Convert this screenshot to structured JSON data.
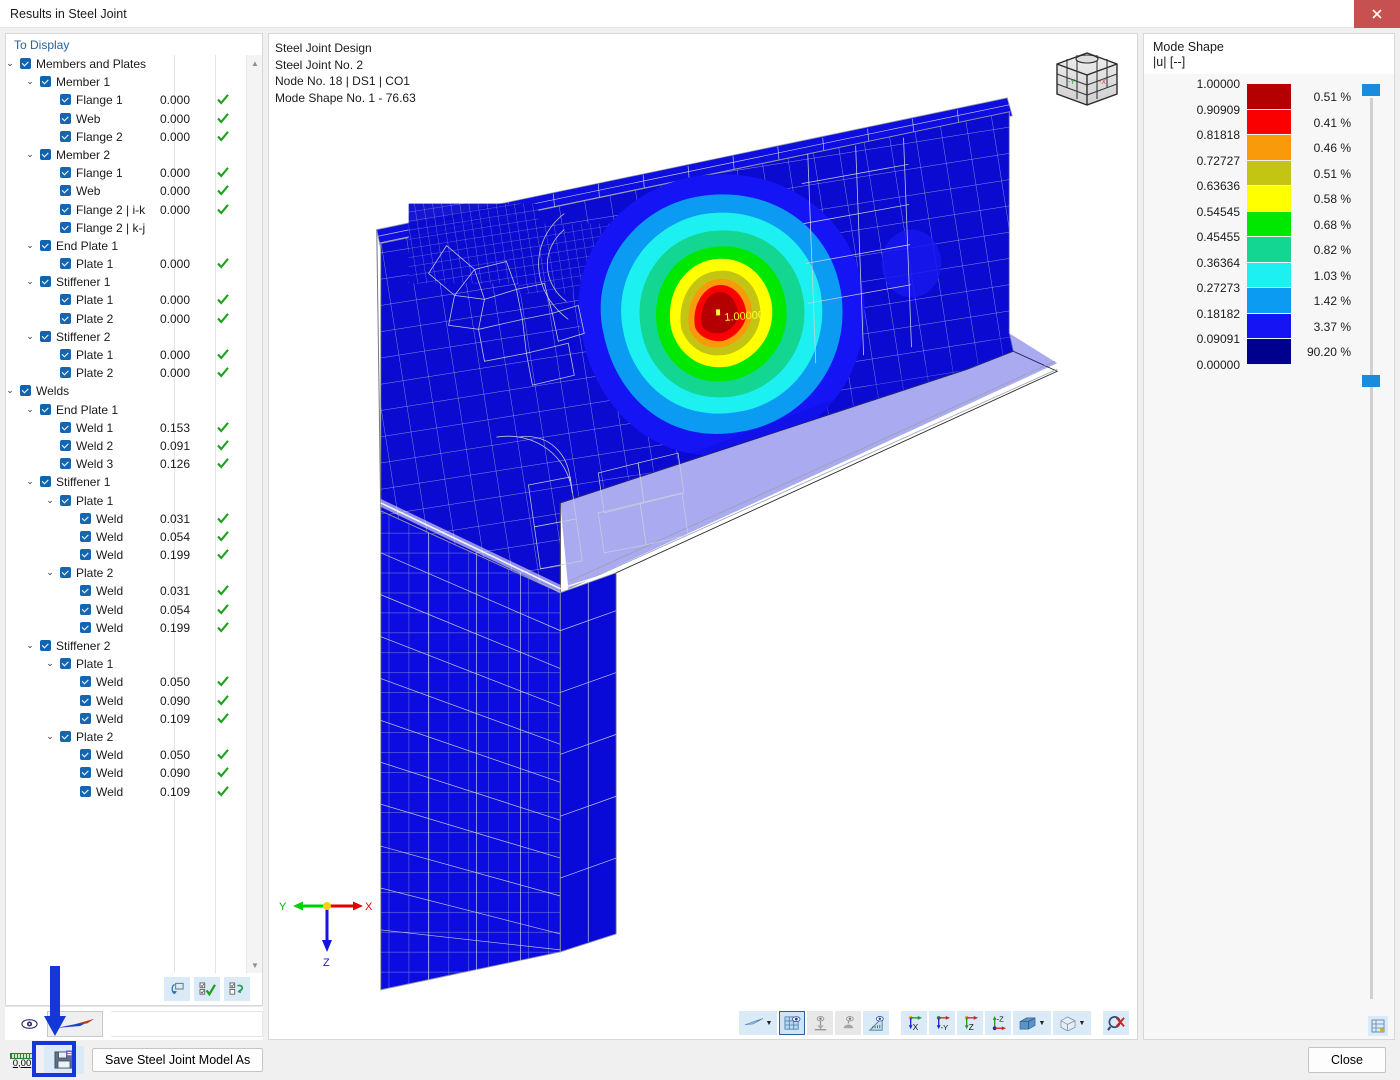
{
  "window": {
    "title": "Results in Steel Joint",
    "close_label": "x"
  },
  "left_panel": {
    "group_label": "To Display",
    "tree": [
      {
        "label": "Members and Plates",
        "depth": 0,
        "chevron": "v",
        "checked": true,
        "value": "",
        "ok": false
      },
      {
        "label": "Member 1",
        "depth": 1,
        "chevron": "v",
        "checked": true,
        "value": "",
        "ok": false
      },
      {
        "label": "Flange 1",
        "depth": 2,
        "chevron": "",
        "checked": true,
        "value": "0.000",
        "ok": true
      },
      {
        "label": "Web",
        "depth": 2,
        "chevron": "",
        "checked": true,
        "value": "0.000",
        "ok": true
      },
      {
        "label": "Flange 2",
        "depth": 2,
        "chevron": "",
        "checked": true,
        "value": "0.000",
        "ok": true
      },
      {
        "label": "Member 2",
        "depth": 1,
        "chevron": "v",
        "checked": true,
        "value": "",
        "ok": false
      },
      {
        "label": "Flange 1",
        "depth": 2,
        "chevron": "",
        "checked": true,
        "value": "0.000",
        "ok": true
      },
      {
        "label": "Web",
        "depth": 2,
        "chevron": "",
        "checked": true,
        "value": "0.000",
        "ok": true
      },
      {
        "label": "Flange 2 | i-k",
        "depth": 2,
        "chevron": "",
        "checked": true,
        "value": "0.000",
        "ok": true
      },
      {
        "label": "Flange 2 | k-j",
        "depth": 2,
        "chevron": "",
        "checked": true,
        "value": "",
        "ok": false
      },
      {
        "label": "End Plate 1",
        "depth": 1,
        "chevron": "v",
        "checked": true,
        "value": "",
        "ok": false
      },
      {
        "label": "Plate 1",
        "depth": 2,
        "chevron": "",
        "checked": true,
        "value": "0.000",
        "ok": true
      },
      {
        "label": "Stiffener 1",
        "depth": 1,
        "chevron": "v",
        "checked": true,
        "value": "",
        "ok": false
      },
      {
        "label": "Plate 1",
        "depth": 2,
        "chevron": "",
        "checked": true,
        "value": "0.000",
        "ok": true
      },
      {
        "label": "Plate 2",
        "depth": 2,
        "chevron": "",
        "checked": true,
        "value": "0.000",
        "ok": true
      },
      {
        "label": "Stiffener 2",
        "depth": 1,
        "chevron": "v",
        "checked": true,
        "value": "",
        "ok": false
      },
      {
        "label": "Plate 1",
        "depth": 2,
        "chevron": "",
        "checked": true,
        "value": "0.000",
        "ok": true
      },
      {
        "label": "Plate 2",
        "depth": 2,
        "chevron": "",
        "checked": true,
        "value": "0.000",
        "ok": true
      },
      {
        "label": "Welds",
        "depth": 0,
        "chevron": "v",
        "checked": true,
        "value": "",
        "ok": false
      },
      {
        "label": "End Plate 1",
        "depth": 1,
        "chevron": "v",
        "checked": true,
        "value": "",
        "ok": false
      },
      {
        "label": "Weld 1",
        "depth": 2,
        "chevron": "",
        "checked": true,
        "value": "0.153",
        "ok": true
      },
      {
        "label": "Weld 2",
        "depth": 2,
        "chevron": "",
        "checked": true,
        "value": "0.091",
        "ok": true
      },
      {
        "label": "Weld 3",
        "depth": 2,
        "chevron": "",
        "checked": true,
        "value": "0.126",
        "ok": true
      },
      {
        "label": "Stiffener 1",
        "depth": 1,
        "chevron": "v",
        "checked": true,
        "value": "",
        "ok": false
      },
      {
        "label": "Plate 1",
        "depth": 2,
        "chevron": "v",
        "checked": true,
        "value": "",
        "ok": false
      },
      {
        "label": "Weld",
        "depth": 3,
        "chevron": "",
        "checked": true,
        "value": "0.031",
        "ok": true
      },
      {
        "label": "Weld",
        "depth": 3,
        "chevron": "",
        "checked": true,
        "value": "0.054",
        "ok": true
      },
      {
        "label": "Weld",
        "depth": 3,
        "chevron": "",
        "checked": true,
        "value": "0.199",
        "ok": true
      },
      {
        "label": "Plate 2",
        "depth": 2,
        "chevron": "v",
        "checked": true,
        "value": "",
        "ok": false
      },
      {
        "label": "Weld",
        "depth": 3,
        "chevron": "",
        "checked": true,
        "value": "0.031",
        "ok": true
      },
      {
        "label": "Weld",
        "depth": 3,
        "chevron": "",
        "checked": true,
        "value": "0.054",
        "ok": true
      },
      {
        "label": "Weld",
        "depth": 3,
        "chevron": "",
        "checked": true,
        "value": "0.199",
        "ok": true
      },
      {
        "label": "Stiffener 2",
        "depth": 1,
        "chevron": "v",
        "checked": true,
        "value": "",
        "ok": false
      },
      {
        "label": "Plate 1",
        "depth": 2,
        "chevron": "v",
        "checked": true,
        "value": "",
        "ok": false
      },
      {
        "label": "Weld",
        "depth": 3,
        "chevron": "",
        "checked": true,
        "value": "0.050",
        "ok": true
      },
      {
        "label": "Weld",
        "depth": 3,
        "chevron": "",
        "checked": true,
        "value": "0.090",
        "ok": true
      },
      {
        "label": "Weld",
        "depth": 3,
        "chevron": "",
        "checked": true,
        "value": "0.109",
        "ok": true
      },
      {
        "label": "Plate 2",
        "depth": 2,
        "chevron": "v",
        "checked": true,
        "value": "",
        "ok": false
      },
      {
        "label": "Weld",
        "depth": 3,
        "chevron": "",
        "checked": true,
        "value": "0.050",
        "ok": true
      },
      {
        "label": "Weld",
        "depth": 3,
        "chevron": "",
        "checked": true,
        "value": "0.090",
        "ok": true
      },
      {
        "label": "Weld",
        "depth": 3,
        "chevron": "",
        "checked": true,
        "value": "0.109",
        "ok": true
      }
    ],
    "toolbar_icons": [
      "reset-view-icon",
      "check-all-icon",
      "invert-selection-icon"
    ],
    "footer_icons": [
      "visibility-eye-icon",
      "result-color-swatch"
    ]
  },
  "viewport": {
    "header_lines": [
      "Steel Joint Design",
      "Steel Joint No. 2",
      "Node No. 18 | DS1 | CO1",
      "Mode Shape No. 1 - 76.63"
    ],
    "peak_label": "1.00000",
    "axes": {
      "x": "X",
      "y": "Y",
      "z": "Z"
    },
    "nav_cube_labels": {
      "minus_y": "-Y",
      "minus_x": "-X"
    },
    "toolbar": [
      {
        "name": "render-mode-icon",
        "caret": true,
        "state": "normal"
      },
      {
        "name": "show-mesh-icon",
        "caret": false,
        "state": "active"
      },
      {
        "name": "show-supports-icon",
        "caret": false,
        "state": "disabled"
      },
      {
        "name": "show-loads-icon",
        "caret": false,
        "state": "disabled"
      },
      {
        "name": "show-dimensions-icon",
        "caret": false,
        "state": "normal"
      },
      {
        "name": "view-in-x-icon",
        "caret": false,
        "state": "normal",
        "label": "X"
      },
      {
        "name": "view-in-minus-y-icon",
        "caret": false,
        "state": "normal",
        "label": "-Y"
      },
      {
        "name": "view-in-z-icon",
        "caret": false,
        "state": "normal",
        "label": "Z"
      },
      {
        "name": "view-in-minus-z-icon",
        "caret": false,
        "state": "normal",
        "label": "-Z"
      },
      {
        "name": "section-view-icon",
        "caret": true,
        "state": "normal"
      },
      {
        "name": "isometric-view-icon",
        "caret": true,
        "state": "normal"
      },
      {
        "name": "reset-zoom-icon",
        "caret": false,
        "state": "normal"
      }
    ]
  },
  "legend": {
    "title": "Mode Shape",
    "subtitle": "|u| [--]",
    "ticks": [
      "1.00000",
      "0.90909",
      "0.81818",
      "0.72727",
      "0.63636",
      "0.54545",
      "0.45455",
      "0.36364",
      "0.27273",
      "0.18182",
      "0.09091",
      "0.00000"
    ],
    "bands": [
      {
        "color": "#b40000",
        "percent": "0.51 %"
      },
      {
        "color": "#fb0000",
        "percent": "0.41 %"
      },
      {
        "color": "#f99a0b",
        "percent": "0.46 %"
      },
      {
        "color": "#c4c413",
        "percent": "0.51 %"
      },
      {
        "color": "#ffff00",
        "percent": "0.58 %"
      },
      {
        "color": "#00e800",
        "percent": "0.68 %"
      },
      {
        "color": "#13d693",
        "percent": "0.82 %"
      },
      {
        "color": "#1cf0f0",
        "percent": "1.03 %"
      },
      {
        "color": "#0b9bf2",
        "percent": "1.42 %"
      },
      {
        "color": "#1414f5",
        "percent": "3.37 %"
      },
      {
        "color": "#00008f",
        "percent": "90.20 %"
      }
    ],
    "slider_handles": [
      "top",
      "bottom"
    ],
    "config_icon": "legend-settings-icon"
  },
  "statusbar": {
    "zero_value": "0,00",
    "ruler_icon": "scale-ruler-icon",
    "save_icon": "save-joint-model-icon",
    "save_as_label": "Save Steel Joint Model As",
    "close_label": "Close",
    "annotation": {
      "type": "arrow-annotation",
      "color": "#1438d8"
    }
  },
  "theme": {
    "accent": "#2a6099",
    "checkbox_blue": "#1263ad",
    "ok_green": "#20a020",
    "annotation_blue": "#1438d8",
    "toolbar_blue": "#dbeaf7",
    "close_red": "#c75050"
  }
}
